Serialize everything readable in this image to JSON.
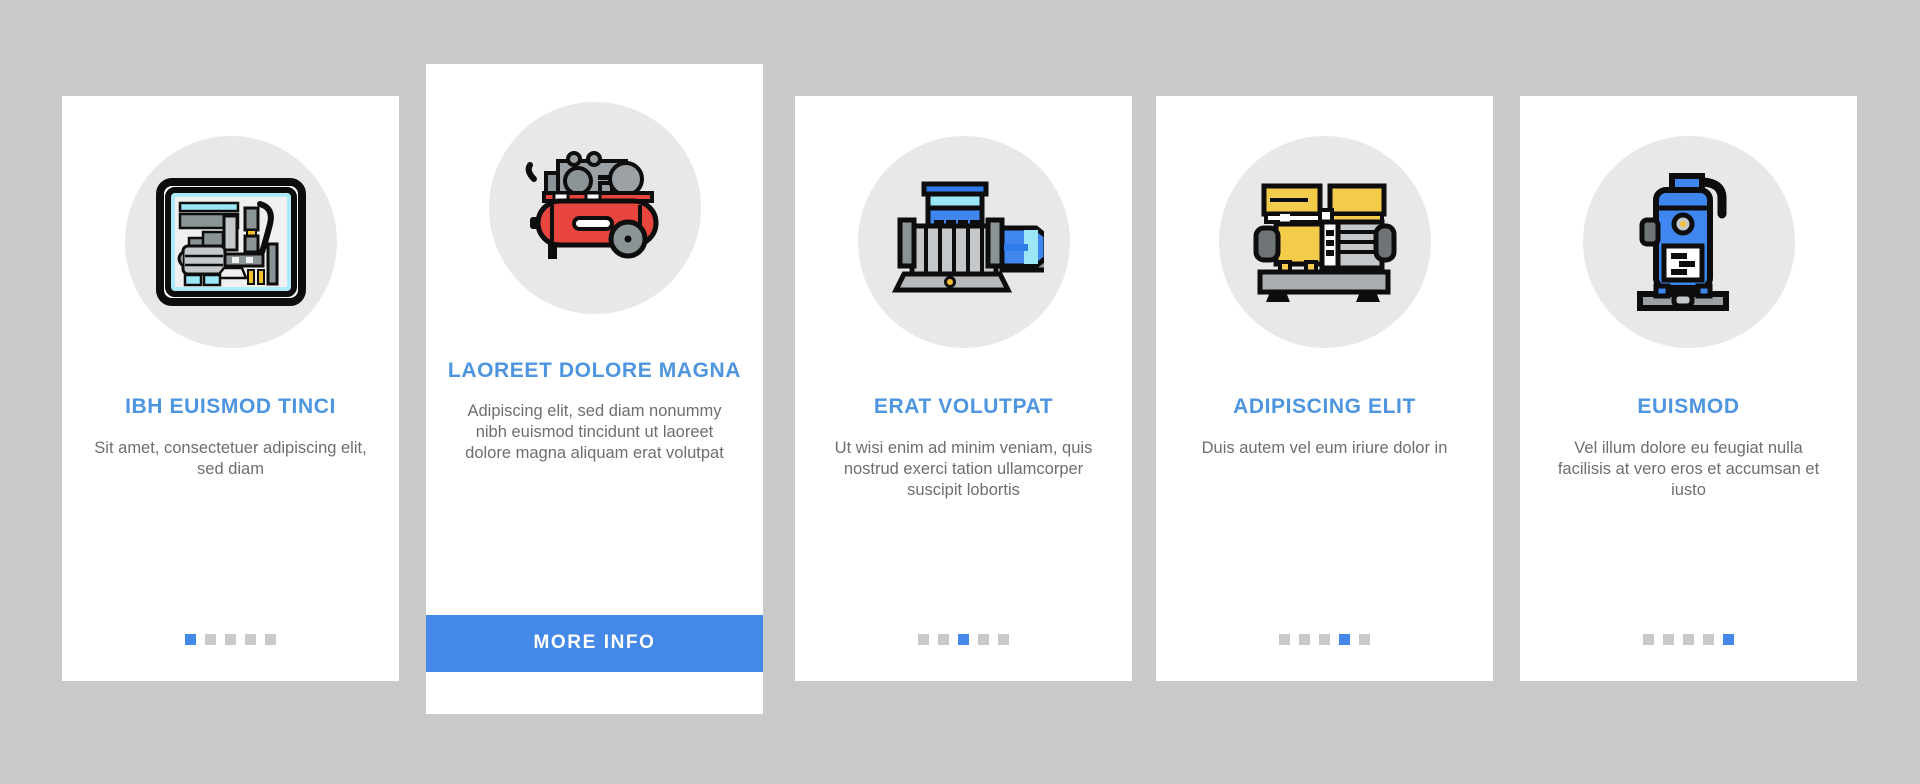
{
  "theme": {
    "background": "#c9c9c9",
    "card_background": "#ffffff",
    "accent_blue": "#4589e8",
    "title_blue": "#4e95e0",
    "body_text": "#6e6e6e",
    "icon_circle": "#e8e8e8",
    "dot_inactive": "#c9c9c9"
  },
  "cards": [
    {
      "icon_name": "control-panel-machinery-icon",
      "title": "IBH EUISMOD TINCI",
      "body": "Sit amet, consectetuer adipiscing elit, sed diam",
      "dots_total": 5,
      "dot_active_index": 0,
      "featured": false
    },
    {
      "icon_name": "red-air-compressor-icon",
      "title": "LAOREET DOLORE MAGNA",
      "body": "Adipiscing elit, sed diam nonummy nibh euismod tincidunt ut laoreet dolore magna aliquam erat volutpat",
      "button_label": "MORE INFO",
      "featured": true
    },
    {
      "icon_name": "industrial-pump-motor-icon",
      "title": "ERAT VOLUTPAT",
      "body": "Ut wisi enim ad minim veniam, quis nostrud exerci tation ullamcorper suscipit lobortis",
      "dots_total": 5,
      "dot_active_index": 2,
      "featured": false
    },
    {
      "icon_name": "yellow-compressor-unit-icon",
      "title": "ADIPISCING ELIT",
      "body": "Duis autem vel eum iriure dolor in",
      "dots_total": 5,
      "dot_active_index": 3,
      "featured": false
    },
    {
      "icon_name": "vertical-tank-compressor-icon",
      "title": "EUISMOD",
      "body": "Vel illum dolore eu feugiat nulla facilisis at vero eros et accumsan et iusto",
      "dots_total": 5,
      "dot_active_index": 4,
      "featured": false
    }
  ]
}
